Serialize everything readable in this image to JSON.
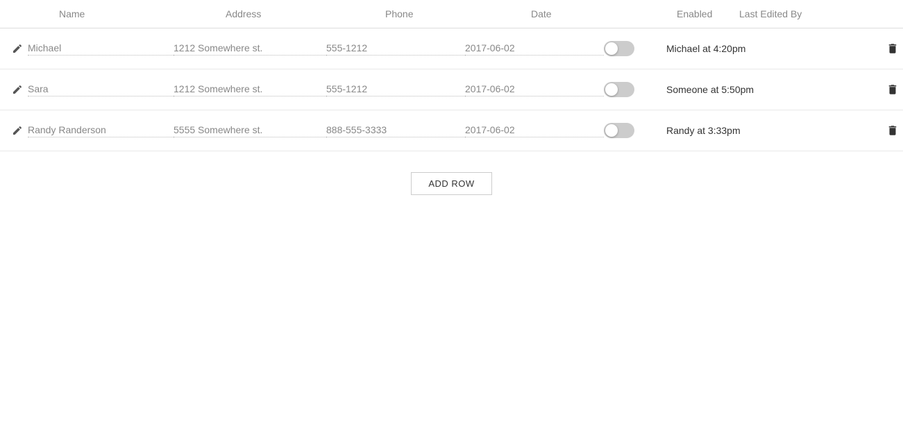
{
  "columns": {
    "name": "Name",
    "address": "Address",
    "phone": "Phone",
    "date": "Date",
    "enabled": "Enabled",
    "last_edited_by": "Last Edited By"
  },
  "rows": [
    {
      "name": "Michael",
      "address": "1212 Somewhere st.",
      "phone": "555-1212",
      "date": "2017-06-02",
      "enabled": false,
      "last_edited_by": "Michael at 4:20pm"
    },
    {
      "name": "Sara",
      "address": "1212 Somewhere st.",
      "phone": "555-1212",
      "date": "2017-06-02",
      "enabled": false,
      "last_edited_by": "Someone at 5:50pm"
    },
    {
      "name": "Randy Randerson",
      "address": "5555 Somewhere st.",
      "phone": "888-555-3333",
      "date": "2017-06-02",
      "enabled": false,
      "last_edited_by": "Randy at 3:33pm"
    }
  ],
  "add_row_label": "ADD ROW"
}
